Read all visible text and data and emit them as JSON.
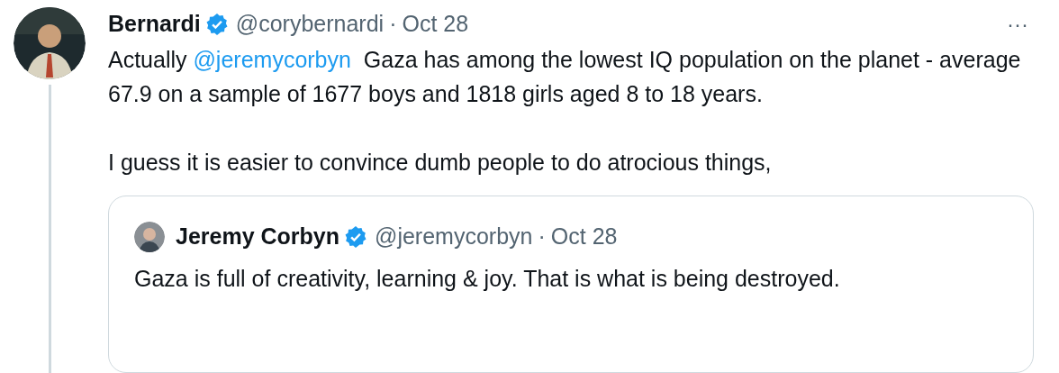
{
  "tweet": {
    "author": {
      "name": "Bernardi",
      "verified": true,
      "handle": "@corybernardi",
      "separator": "·",
      "date": "Oct 28"
    },
    "more": "···",
    "paragraphs": [
      [
        {
          "kind": "text",
          "text": "Actually "
        },
        {
          "kind": "mention",
          "text": "@jeremycorbyn"
        },
        {
          "kind": "text",
          "text": "  Gaza has among the lowest IQ population on the planet - average 67.9 on a sample of 1677 boys and 1818 girls aged 8 to 18 years."
        }
      ],
      [
        {
          "kind": "text",
          "text": "I guess it is easier to convince dumb people to do atrocious things,"
        }
      ]
    ],
    "quote": {
      "author": {
        "name": "Jeremy Corbyn",
        "verified": true,
        "handle": "@jeremycorbyn",
        "separator": "·",
        "date": "Oct 28"
      },
      "text": "Gaza is full of creativity, learning & joy. That is what is being destroyed."
    }
  }
}
